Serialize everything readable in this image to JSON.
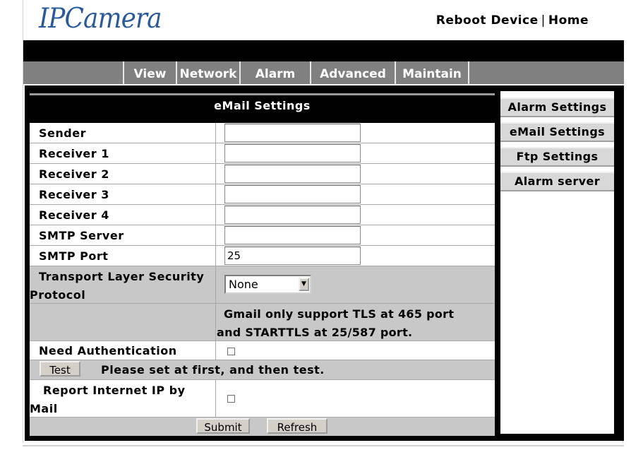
{
  "header": {
    "logo_text": "IPCamera",
    "reboot_label": "Reboot Device",
    "separator": "|",
    "home_label": "Home"
  },
  "nav": {
    "items": [
      "View",
      "Network",
      "Alarm",
      "Advanced",
      "Maintain"
    ]
  },
  "panel": {
    "title": "eMail Settings",
    "fields": [
      {
        "label": "Sender",
        "value": ""
      },
      {
        "label": "Receiver 1",
        "value": ""
      },
      {
        "label": "Receiver 2",
        "value": ""
      },
      {
        "label": "Receiver 3",
        "value": ""
      },
      {
        "label": "Receiver 4",
        "value": ""
      },
      {
        "label": "SMTP Server",
        "value": ""
      },
      {
        "label": "SMTP Port",
        "value": "25"
      }
    ],
    "tls_label_line1": "Transport Layer Security",
    "tls_label_line2": "Protocol",
    "tls_selected": "None",
    "gmail_note_line1": "Gmail only support TLS at 465 port",
    "gmail_note_line2": "and STARTTLS at 25/587 port.",
    "need_auth_label": "Need Authentication",
    "need_auth_checked": false,
    "test_button": "Test",
    "test_note": "Please set at first, and then test.",
    "report_ip_line1": "Report Internet IP by",
    "report_ip_line2": "Mail",
    "report_ip_checked": false,
    "submit_button": "Submit",
    "refresh_button": "Refresh"
  },
  "sidebar": {
    "items": [
      "Alarm Settings",
      "eMail Settings",
      "Ftp Settings",
      "Alarm server"
    ]
  }
}
